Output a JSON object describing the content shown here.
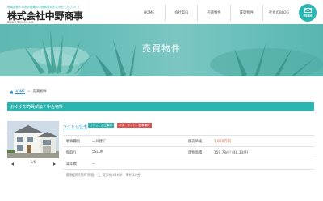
{
  "header": {
    "tagline": "地域密着５０年の信頼の中野商事がおまかせください！！",
    "logo_text": "株式会社中野商事",
    "logo_sub": "Nakano Shoji Co., Ltd.",
    "nav": [
      "HOME",
      "会社案内",
      "売買物件",
      "賃貸物件",
      "社長のBLOG"
    ],
    "mail_label": "mail"
  },
  "hero": {
    "title": "売買物件"
  },
  "breadcrumb": {
    "home": "HOME",
    "current": "売買物件"
  },
  "section": {
    "title": "おすすめ売買新築・中古物件"
  },
  "listing": {
    "photo_counter": "1/6",
    "name": "ワイドな住宅",
    "tags": [
      "リフォーム工事済",
      "バス・ワイド・駐車場付"
    ],
    "rows": [
      {
        "label1": "物件種別",
        "value1": "一戸建て",
        "label2": "販売価格",
        "value2": "1,850万円"
      },
      {
        "label1": "間取り",
        "value1": "5SLDK",
        "label2": "建物面積",
        "value2": "159.78m² (48.33坪)"
      },
      {
        "label1": "築年数",
        "value1": "ー"
      }
    ],
    "address": "稲敷郡阿見町青宿／上 徒歩約41KM　車約10分"
  },
  "colors": {
    "accent": "#2bb5b0",
    "price": "#e05a2a",
    "link": "#2b8ac9"
  }
}
